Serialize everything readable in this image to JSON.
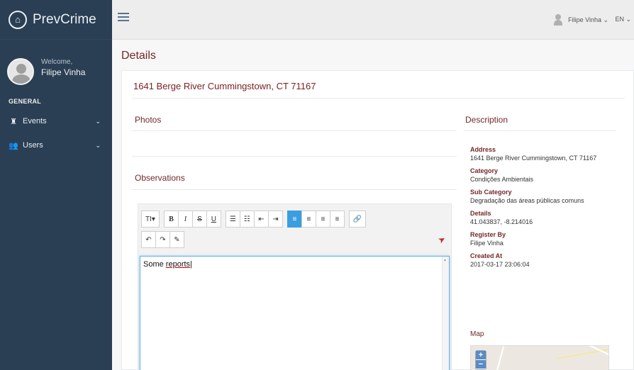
{
  "brand": {
    "name": "PrevCrime",
    "icon": "building-shield-icon"
  },
  "profile": {
    "welcome": "Welcome,",
    "name": "Filipe Vinha"
  },
  "sidebar": {
    "section": "GENERAL",
    "items": [
      {
        "label": "Events",
        "icon": "events-icon"
      },
      {
        "label": "Users",
        "icon": "users-icon"
      }
    ]
  },
  "topbar": {
    "user": "Filipe Vinha ⌄",
    "lang": "EN ⌄"
  },
  "page": {
    "title": "Details"
  },
  "details": {
    "address_title": "1641 Berge River Cummingstown, CT 71167",
    "photos_heading": "Photos",
    "observations_heading": "Observations",
    "description_heading": "Description",
    "map_label": "Map"
  },
  "editor": {
    "text_plain": "Some ",
    "text_spelled": "reports",
    "toolbar": {
      "font": "TI▾",
      "bold": "B",
      "italic": "I",
      "strike": "S",
      "underline": "U",
      "ul": "☰",
      "ol": "☷",
      "outdent": "⇤",
      "indent": "⇥",
      "align_left": "≡",
      "align_center": "≡",
      "align_right": "≡",
      "justify": "≡",
      "link": "🔗",
      "undo": "↶",
      "redo": "↷",
      "pen": "✎"
    }
  },
  "description": {
    "address_label": "Address",
    "address_value": "1641 Berge River Cummingstown, CT 71167",
    "category_label": "Category",
    "category_value": "Condições Ambientais",
    "subcategory_label": "Sub Category",
    "subcategory_value": "Degradação das áreas públicas comuns",
    "details_label": "Details",
    "details_value": "41.043837, -8.214016",
    "register_label": "Register By",
    "register_value": "Filipe Vinha",
    "created_label": "Created At",
    "created_value": "2017-03-17 23:06:04"
  },
  "map_controls": {
    "zoom_in": "+",
    "zoom_out": "−"
  },
  "colors": {
    "sidebar": "#2a3f54",
    "accent": "#73282b",
    "active_button": "#3a9ee0"
  }
}
